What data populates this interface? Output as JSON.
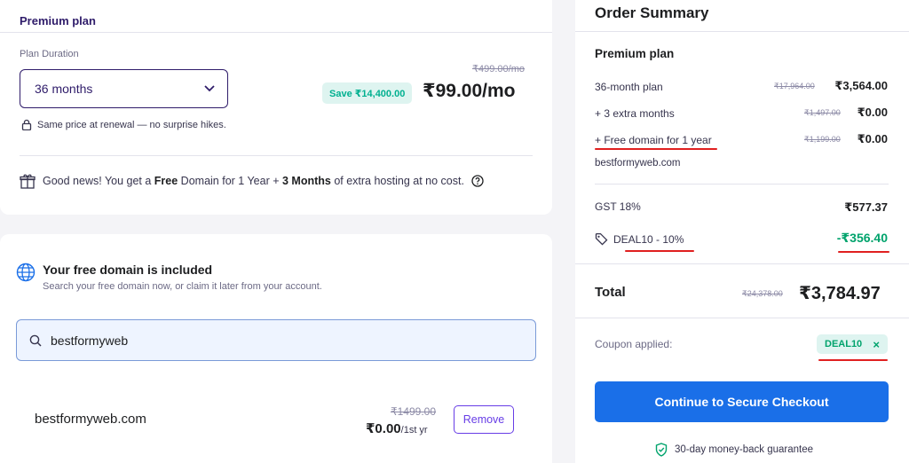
{
  "plan": {
    "title": "Premium plan",
    "duration_label": "Plan Duration",
    "duration_value": "36 months",
    "old_price": "₹499.00/mo",
    "save_badge": "Save ₹14,400.00",
    "price": "₹99.00/mo",
    "renewal_note": "Same price at renewal — no surprise hikes.",
    "goodnews_prefix": "Good news! You get a ",
    "goodnews_free": "Free",
    "goodnews_mid": " Domain for 1 Year + ",
    "goodnews_months": "3 Months",
    "goodnews_suffix": " of extra hosting at no cost."
  },
  "domain": {
    "title": "Your free domain is included",
    "subtitle": "Search your free domain now, or claim it later from your account.",
    "search_value": "bestformyweb",
    "result_name": "bestformyweb.com",
    "result_old_price": "₹1499.00",
    "result_price": "₹0.00",
    "result_period": "/1st yr",
    "remove_label": "Remove"
  },
  "summary": {
    "title": "Order Summary",
    "plan_name": "Premium plan",
    "rows": [
      {
        "label": "36-month plan",
        "old": "₹17,964.00",
        "value": "₹3,564.00"
      },
      {
        "label": "+ 3 extra months",
        "old": "₹1,497.00",
        "value": "₹0.00"
      },
      {
        "label": "+ Free domain for 1 year",
        "old": "₹1,199.00",
        "value": "₹0.00"
      }
    ],
    "domain_name": "bestformyweb.com",
    "gst_label": "GST 18%",
    "gst_value": "₹577.37",
    "discount_label": "DEAL10 - 10%",
    "discount_value": "-₹356.40",
    "total_label": "Total",
    "total_old": "₹24,378.00",
    "total_value": "₹3,784.97",
    "coupon_label": "Coupon applied:",
    "coupon_code": "DEAL10",
    "coupon_remove": "×",
    "checkout_label": "Continue to Secure Checkout",
    "guarantee": "30-day money-back guarantee"
  },
  "colors": {
    "brand_purple": "#673de6",
    "checkout_blue": "#1a6fe8",
    "success_green": "#00a36c",
    "annotation_red": "#e02020"
  },
  "icons": [
    "chevron-down-icon",
    "lock-icon",
    "gift-icon",
    "help-circle-icon",
    "globe-icon",
    "search-icon",
    "tag-icon",
    "close-icon",
    "shield-check-icon"
  ]
}
